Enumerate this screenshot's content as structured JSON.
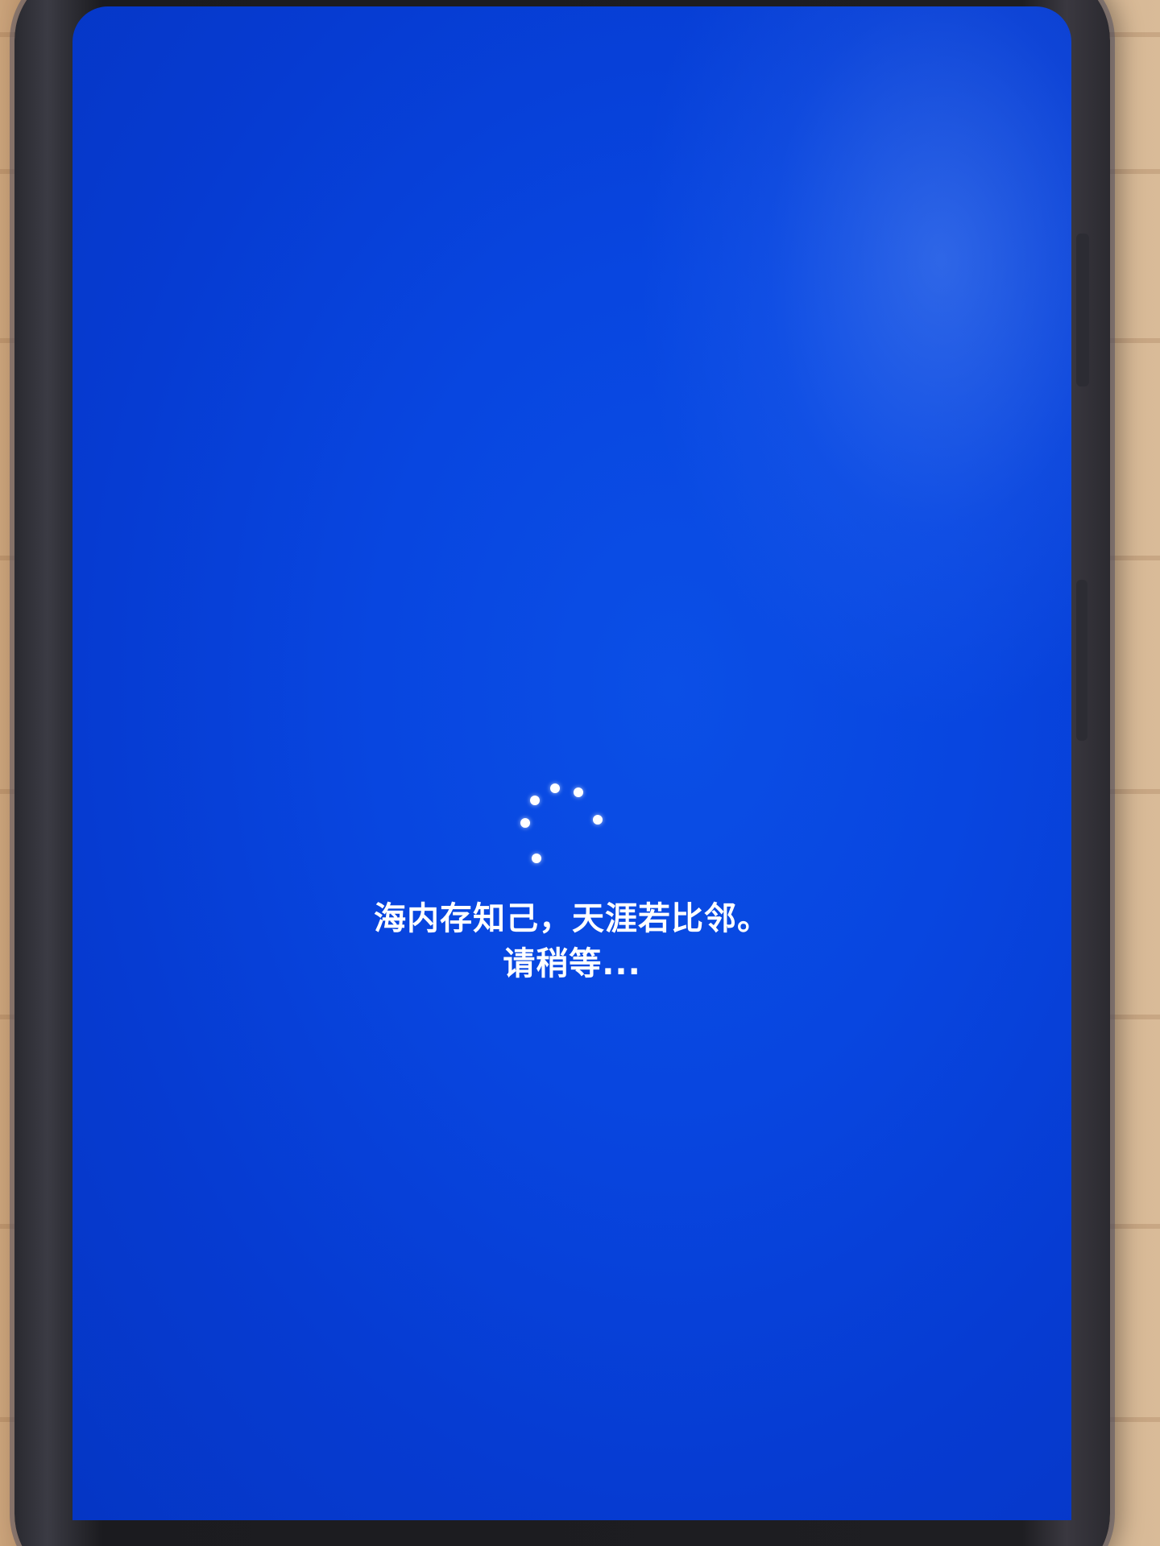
{
  "screen": {
    "background_color": "#0846e0",
    "text_color": "#ffffff"
  },
  "spinner": {
    "icon": "loading-spinner-icon"
  },
  "message": {
    "line1": "海内存知己，天涯若比邻。",
    "line2": "请稍等..."
  }
}
